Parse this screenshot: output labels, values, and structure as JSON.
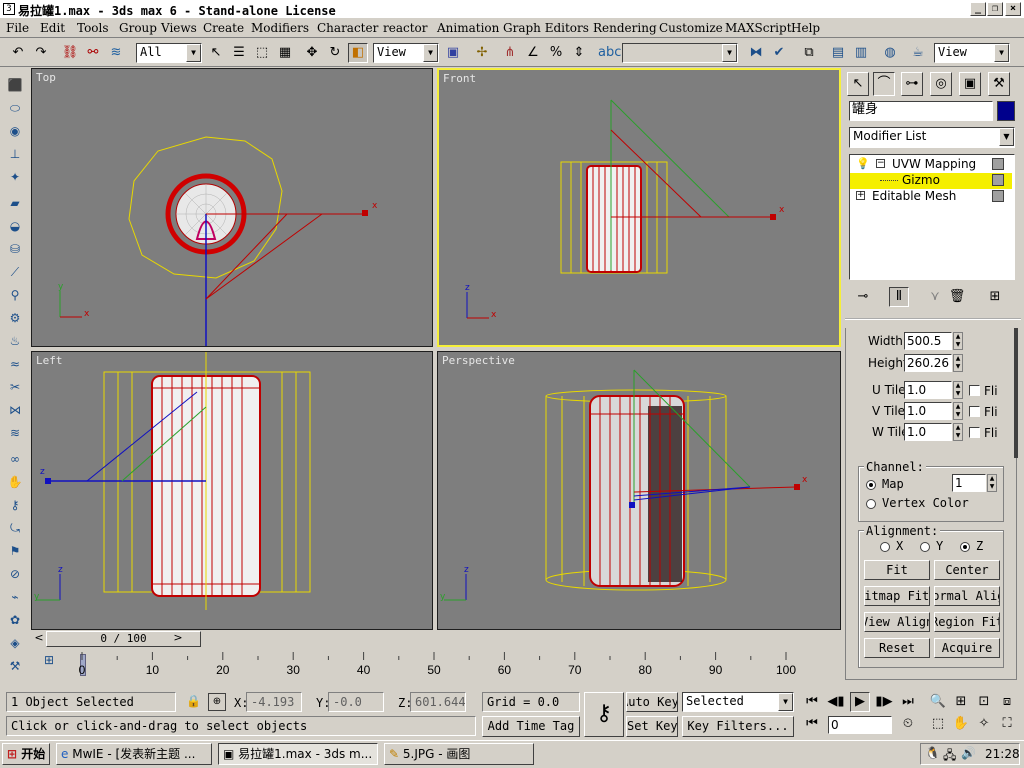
{
  "window": {
    "title": "易拉罐1.max - 3ds max 6 - Stand-alone License",
    "app_icon": "3ds-icon"
  },
  "menu": [
    "File",
    "Edit",
    "Tools",
    "Group",
    "Views",
    "Create",
    "Modifiers",
    "Character",
    "reactor",
    "Animation",
    "Graph Editors",
    "Rendering",
    "Customize",
    "MAXScript",
    "Help"
  ],
  "toolbar": {
    "selection_filter": "All",
    "ref_coord": "View",
    "named_sel": "",
    "view_right": "View"
  },
  "viewports": {
    "top": "Top",
    "front": "Front",
    "left": "Left",
    "perspective": "Perspective",
    "axis_x": "x",
    "axis_y": "y",
    "axis_z": "z"
  },
  "timeline": {
    "frame": "0 / 100",
    "prev": "<",
    "next": ">"
  },
  "ruler_ticks": [
    "0",
    "10",
    "20",
    "30",
    "40",
    "50",
    "60",
    "70",
    "80",
    "90",
    "100"
  ],
  "panel": {
    "object_name": "罐身",
    "object_color": "#00008c",
    "modifier_list": "Modifier List",
    "stack": {
      "uvw": "UVW Mapping",
      "gizmo": "Gizmo",
      "mesh": "Editable Mesh"
    },
    "params": {
      "width_label": "Width:",
      "width": "500.5",
      "height_label": "Height:",
      "height": "260.26",
      "utile_label": "U Tile:",
      "utile": "1.0",
      "vtile_label": "V Tile:",
      "vtile": "1.0",
      "wtile_label": "W Tile:",
      "wtile": "1.0",
      "flip": "Fli"
    },
    "channel": {
      "title": "Channel:",
      "map": "Map",
      "map_value": "1",
      "vertex": "Vertex Color"
    },
    "alignment": {
      "title": "Alignment:",
      "x": "X",
      "y": "Y",
      "z": "Z",
      "fit": "Fit",
      "center": "Center",
      "bitmap_fit": "Bitmap Fit",
      "normal_align": "Normal Align",
      "view_align": "View Align",
      "region_fit": "Region Fit",
      "reset": "Reset",
      "acquire": "Acquire"
    }
  },
  "status": {
    "selected": "1 Object Selected",
    "prompt": "Click or click-and-drag to select objects",
    "x_label": "X:",
    "x": "-4.193",
    "y_label": "Y:",
    "y": "-0.0",
    "z_label": "Z:",
    "z": "601.644",
    "grid": "Grid = 0.0",
    "add_time_tag": "Add Time Tag",
    "auto_key": "Auto Key",
    "set_key": "Set Key",
    "key_mode": "Selected",
    "key_filters": "Key Filters...",
    "frame_field": "0"
  },
  "taskbar": {
    "start": "开始",
    "tasks": [
      "MwIE - [发表新主题 ...",
      "易拉罐1.max - 3ds m...",
      "5.JPG - 画图"
    ],
    "clock": "21:28"
  }
}
